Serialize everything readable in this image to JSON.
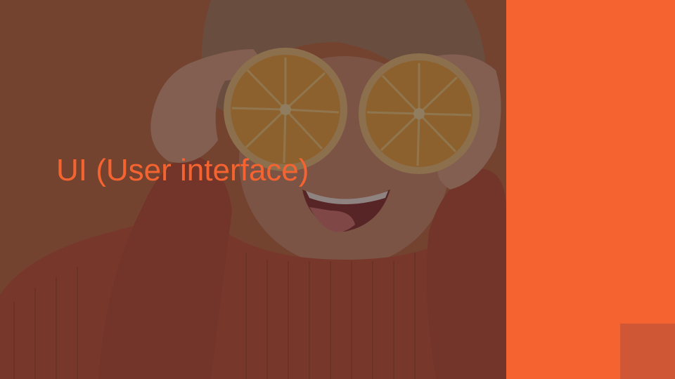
{
  "slide": {
    "title": "UI (User interface)"
  },
  "colors": {
    "accent": "#f56430",
    "accent_dark": "#cf5735",
    "overlay": "#3a2a2a"
  },
  "photo": {
    "subject": "woman holding orange halves over her eyes"
  }
}
